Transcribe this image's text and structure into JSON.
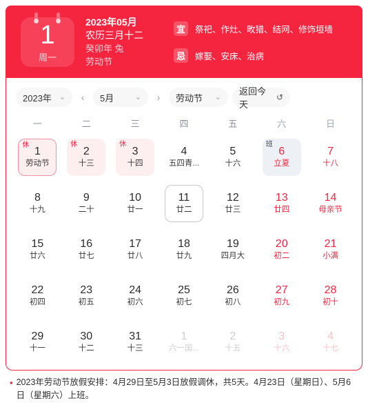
{
  "header": {
    "icon_day": "1",
    "icon_weekday": "周一",
    "line1": "2023年05月",
    "line2": "农历三月十二",
    "line3": "癸卯年 兔",
    "line4": "劳动节",
    "yi_label": "宜",
    "yi_text": "祭祀、作灶、畋猎、结网、修饰垣墙",
    "ji_label": "忌",
    "ji_text": "嫁娶、安床、治病",
    "bg_color": "#f6253f"
  },
  "toolbar": {
    "year_value": "2023年",
    "month_value": "5月",
    "festival_value": "劳动节",
    "today_label": "返回今天",
    "prev_icon": "‹",
    "next_icon": "›",
    "chevron_icon": "⌄",
    "refresh_icon": "↺"
  },
  "weekdays": [
    {
      "label": "一",
      "weekend": false
    },
    {
      "label": "二",
      "weekend": false
    },
    {
      "label": "三",
      "weekend": false
    },
    {
      "label": "四",
      "weekend": false
    },
    {
      "label": "五",
      "weekend": false
    },
    {
      "label": "六",
      "weekend": true
    },
    {
      "label": "日",
      "weekend": true
    }
  ],
  "days": [
    {
      "num": "1",
      "lunar": "劳动节",
      "state": "selected",
      "badge": "休",
      "weekend": false,
      "out": false
    },
    {
      "num": "2",
      "lunar": "十三",
      "state": "rest",
      "badge": "休",
      "weekend": false,
      "out": false
    },
    {
      "num": "3",
      "lunar": "十四",
      "state": "rest",
      "badge": "休",
      "weekend": false,
      "out": false
    },
    {
      "num": "4",
      "lunar": "五四青...",
      "state": "",
      "badge": "",
      "weekend": false,
      "out": false
    },
    {
      "num": "5",
      "lunar": "十六",
      "state": "",
      "badge": "",
      "weekend": false,
      "out": false
    },
    {
      "num": "6",
      "lunar": "立夏",
      "state": "work",
      "badge": "班",
      "weekend": true,
      "out": false
    },
    {
      "num": "7",
      "lunar": "十八",
      "state": "",
      "badge": "",
      "weekend": true,
      "out": false
    },
    {
      "num": "8",
      "lunar": "十九",
      "state": "",
      "badge": "",
      "weekend": false,
      "out": false
    },
    {
      "num": "9",
      "lunar": "二十",
      "state": "",
      "badge": "",
      "weekend": false,
      "out": false
    },
    {
      "num": "10",
      "lunar": "廿一",
      "state": "",
      "badge": "",
      "weekend": false,
      "out": false
    },
    {
      "num": "11",
      "lunar": "廿二",
      "state": "today-mark",
      "badge": "",
      "weekend": false,
      "out": false
    },
    {
      "num": "12",
      "lunar": "廿三",
      "state": "",
      "badge": "",
      "weekend": false,
      "out": false
    },
    {
      "num": "13",
      "lunar": "廿四",
      "state": "",
      "badge": "",
      "weekend": true,
      "out": false
    },
    {
      "num": "14",
      "lunar": "母亲节",
      "state": "",
      "badge": "",
      "weekend": true,
      "out": false
    },
    {
      "num": "15",
      "lunar": "廿六",
      "state": "",
      "badge": "",
      "weekend": false,
      "out": false
    },
    {
      "num": "16",
      "lunar": "廿七",
      "state": "",
      "badge": "",
      "weekend": false,
      "out": false
    },
    {
      "num": "17",
      "lunar": "廿八",
      "state": "",
      "badge": "",
      "weekend": false,
      "out": false
    },
    {
      "num": "18",
      "lunar": "廿九",
      "state": "",
      "badge": "",
      "weekend": false,
      "out": false
    },
    {
      "num": "19",
      "lunar": "四月大",
      "state": "",
      "badge": "",
      "weekend": false,
      "out": false
    },
    {
      "num": "20",
      "lunar": "初二",
      "state": "",
      "badge": "",
      "weekend": true,
      "out": false
    },
    {
      "num": "21",
      "lunar": "小满",
      "state": "",
      "badge": "",
      "weekend": true,
      "out": false
    },
    {
      "num": "22",
      "lunar": "初四",
      "state": "",
      "badge": "",
      "weekend": false,
      "out": false
    },
    {
      "num": "23",
      "lunar": "初五",
      "state": "",
      "badge": "",
      "weekend": false,
      "out": false
    },
    {
      "num": "24",
      "lunar": "初六",
      "state": "",
      "badge": "",
      "weekend": false,
      "out": false
    },
    {
      "num": "25",
      "lunar": "初七",
      "state": "",
      "badge": "",
      "weekend": false,
      "out": false
    },
    {
      "num": "26",
      "lunar": "初八",
      "state": "",
      "badge": "",
      "weekend": false,
      "out": false
    },
    {
      "num": "27",
      "lunar": "初九",
      "state": "",
      "badge": "",
      "weekend": true,
      "out": false
    },
    {
      "num": "28",
      "lunar": "初十",
      "state": "",
      "badge": "",
      "weekend": true,
      "out": false
    },
    {
      "num": "29",
      "lunar": "十一",
      "state": "",
      "badge": "",
      "weekend": false,
      "out": false
    },
    {
      "num": "30",
      "lunar": "十二",
      "state": "",
      "badge": "",
      "weekend": false,
      "out": false
    },
    {
      "num": "31",
      "lunar": "十三",
      "state": "",
      "badge": "",
      "weekend": false,
      "out": false
    },
    {
      "num": "1",
      "lunar": "六一国...",
      "state": "",
      "badge": "",
      "weekend": false,
      "out": true
    },
    {
      "num": "2",
      "lunar": "十五",
      "state": "",
      "badge": "",
      "weekend": false,
      "out": true
    },
    {
      "num": "3",
      "lunar": "十六",
      "state": "",
      "badge": "",
      "weekend": true,
      "out": true
    },
    {
      "num": "4",
      "lunar": "十七",
      "state": "",
      "badge": "",
      "weekend": true,
      "out": true
    }
  ],
  "footer": {
    "bullet": "▪",
    "text": "2023年劳动节放假安排：4月29日至5月3日放假调休，共5天。4月23日（星期日）、5月6日（星期六）上班。"
  }
}
